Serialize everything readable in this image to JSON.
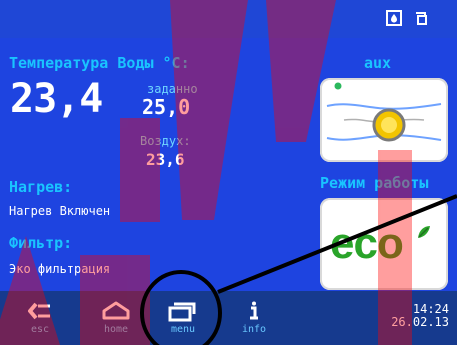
{
  "top": {
    "icons": [
      "drop-icon",
      "copy-icon"
    ]
  },
  "left": {
    "title": "Температура Воды",
    "unit": "°C:",
    "current_temp": "23,4",
    "set_label": "заданно",
    "set_value": "25,0",
    "air_label": "Воздух:",
    "air_value": "23,6",
    "heating_label": "Нагрев:",
    "heating_status": "Нагрев Включен",
    "filter_label": "Фильтр:",
    "filter_status": "Эко фильтрация"
  },
  "right": {
    "aux_label": "aux",
    "mode_label": "Режим работы",
    "eco_text": "eco"
  },
  "bottom": {
    "esc": "esc",
    "home": "home",
    "menu": "menu",
    "info": "info",
    "time": "14:24",
    "date": "26.02.13"
  },
  "colors": {
    "main_bg": "#1e44e0",
    "bar_bg": "#163a8e",
    "accent": "#19c4ff",
    "eco_green": "#2aa42a",
    "watermark": "#ff0000",
    "annotation": "#000000"
  }
}
